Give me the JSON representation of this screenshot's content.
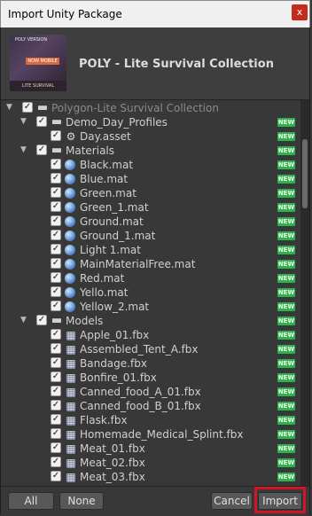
{
  "dialog": {
    "title": "Import Unity Package",
    "close_label": "x",
    "package_name": "POLY - Lite Survival Collection",
    "thumbnail": {
      "lines": [
        "POLY VERSION",
        "LITE SURVIVAL COLLECTION",
        "NOW MOBILE"
      ]
    }
  },
  "tree": {
    "new_badge_label": "NEW",
    "rows": [
      {
        "level": 0,
        "arrow": "▼",
        "checked": true,
        "icon": "folder",
        "label": "Polygon-Lite Survival Collection",
        "badge": false,
        "root": true
      },
      {
        "level": 1,
        "arrow": "▼",
        "checked": true,
        "icon": "folder",
        "label": "Demo_Day_Profiles",
        "badge": true
      },
      {
        "level": 2,
        "arrow": "",
        "checked": true,
        "icon": "asset",
        "label": "Day.asset",
        "badge": true
      },
      {
        "level": 1,
        "arrow": "▼",
        "checked": true,
        "icon": "folder",
        "label": "Materials",
        "badge": true
      },
      {
        "level": 2,
        "arrow": "",
        "checked": true,
        "icon": "mat",
        "label": "Black.mat",
        "badge": true
      },
      {
        "level": 2,
        "arrow": "",
        "checked": true,
        "icon": "mat",
        "label": "Blue.mat",
        "badge": true
      },
      {
        "level": 2,
        "arrow": "",
        "checked": true,
        "icon": "mat",
        "label": "Green.mat",
        "badge": true
      },
      {
        "level": 2,
        "arrow": "",
        "checked": true,
        "icon": "mat",
        "label": "Green_1.mat",
        "badge": true
      },
      {
        "level": 2,
        "arrow": "",
        "checked": true,
        "icon": "mat",
        "label": "Ground.mat",
        "badge": true
      },
      {
        "level": 2,
        "arrow": "",
        "checked": true,
        "icon": "mat",
        "label": "Ground_1.mat",
        "badge": true
      },
      {
        "level": 2,
        "arrow": "",
        "checked": true,
        "icon": "mat",
        "label": "Light 1.mat",
        "badge": true
      },
      {
        "level": 2,
        "arrow": "",
        "checked": true,
        "icon": "mat",
        "label": "MainMaterialFree.mat",
        "badge": true
      },
      {
        "level": 2,
        "arrow": "",
        "checked": true,
        "icon": "mat",
        "label": "Red.mat",
        "badge": true
      },
      {
        "level": 2,
        "arrow": "",
        "checked": true,
        "icon": "mat",
        "label": "Yello.mat",
        "badge": true
      },
      {
        "level": 2,
        "arrow": "",
        "checked": true,
        "icon": "mat",
        "label": "Yellow_2.mat",
        "badge": true
      },
      {
        "level": 1,
        "arrow": "▼",
        "checked": true,
        "icon": "folder",
        "label": "Models",
        "badge": true
      },
      {
        "level": 2,
        "arrow": "",
        "checked": true,
        "icon": "fbx",
        "label": "Apple_01.fbx",
        "badge": true
      },
      {
        "level": 2,
        "arrow": "",
        "checked": true,
        "icon": "fbx",
        "label": "Assembled_Tent_A.fbx",
        "badge": true
      },
      {
        "level": 2,
        "arrow": "",
        "checked": true,
        "icon": "fbx",
        "label": "Bandage.fbx",
        "badge": true
      },
      {
        "level": 2,
        "arrow": "",
        "checked": true,
        "icon": "fbx",
        "label": "Bonfire_01.fbx",
        "badge": true
      },
      {
        "level": 2,
        "arrow": "",
        "checked": true,
        "icon": "fbx",
        "label": "Canned_food_A_01.fbx",
        "badge": true
      },
      {
        "level": 2,
        "arrow": "",
        "checked": true,
        "icon": "fbx",
        "label": "Canned_food_B_01.fbx",
        "badge": true
      },
      {
        "level": 2,
        "arrow": "",
        "checked": true,
        "icon": "fbx",
        "label": "Flask.fbx",
        "badge": true
      },
      {
        "level": 2,
        "arrow": "",
        "checked": true,
        "icon": "fbx",
        "label": "Homemade_Medical_Splint.fbx",
        "badge": true
      },
      {
        "level": 2,
        "arrow": "",
        "checked": true,
        "icon": "fbx",
        "label": "Meat_01.fbx",
        "badge": true
      },
      {
        "level": 2,
        "arrow": "",
        "checked": true,
        "icon": "fbx",
        "label": "Meat_02.fbx",
        "badge": true
      },
      {
        "level": 2,
        "arrow": "",
        "checked": true,
        "icon": "fbx",
        "label": "Meat_03.fbx",
        "badge": true
      }
    ]
  },
  "footer": {
    "all": "All",
    "none": "None",
    "cancel": "Cancel",
    "import": "Import"
  }
}
